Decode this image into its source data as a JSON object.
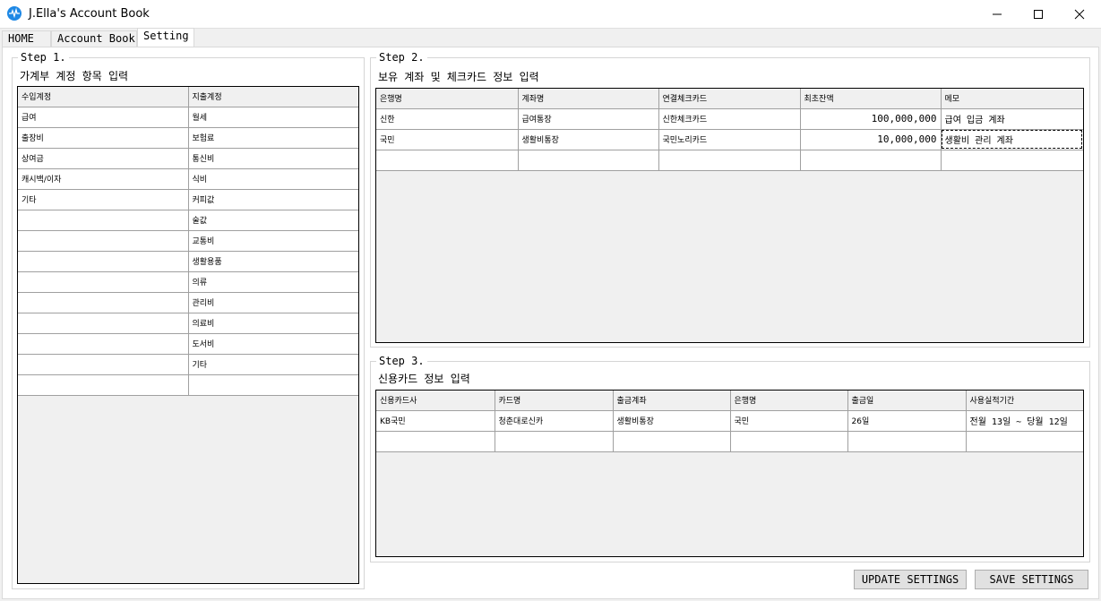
{
  "window": {
    "title": "J.Ella's Account Book"
  },
  "tabs": [
    {
      "label": "HOME"
    },
    {
      "label": "Account Book"
    },
    {
      "label": "Setting"
    }
  ],
  "step1": {
    "title": "Step 1.",
    "subtitle": "가계부 계정 항목 입력",
    "headers": [
      "수입계정",
      "지출계정"
    ],
    "rows": [
      [
        "급여",
        "월세"
      ],
      [
        "출장비",
        "보험료"
      ],
      [
        "상여금",
        "통신비"
      ],
      [
        "캐시백/이자",
        "식비"
      ],
      [
        "기타",
        "커피값"
      ],
      [
        "",
        "술값"
      ],
      [
        "",
        "교통비"
      ],
      [
        "",
        "생활용품"
      ],
      [
        "",
        "의류"
      ],
      [
        "",
        "관리비"
      ],
      [
        "",
        "의료비"
      ],
      [
        "",
        "도서비"
      ],
      [
        "",
        "기타"
      ],
      [
        "",
        ""
      ]
    ]
  },
  "step2": {
    "title": "Step 2.",
    "subtitle": "보유 계좌 및 체크카드 정보 입력",
    "headers": [
      "은행명",
      "계좌명",
      "연결체크카드",
      "최초잔액",
      "메모"
    ],
    "rows": [
      [
        "신한",
        "급여통장",
        "신한체크카드",
        "100,000,000",
        "급여 입금 계좌"
      ],
      [
        "국민",
        "생활비통장",
        "국민노리카드",
        "10,000,000",
        "생활비 관리 계좌"
      ],
      [
        "",
        "",
        "",
        "",
        ""
      ]
    ]
  },
  "step3": {
    "title": "Step 3.",
    "subtitle": "신용카드 정보 입력",
    "headers": [
      "신용카드사",
      "카드명",
      "출금계좌",
      "은행명",
      "출금일",
      "사용실적기간"
    ],
    "rows": [
      [
        "KB국민",
        "청춘대로신카",
        "생활비통장",
        "국민",
        "26일",
        "전월 13일 ~ 당월 12일"
      ],
      [
        "",
        "",
        "",
        "",
        "",
        ""
      ]
    ]
  },
  "buttons": {
    "update": "UPDATE SETTINGS",
    "save": "SAVE SETTINGS"
  }
}
